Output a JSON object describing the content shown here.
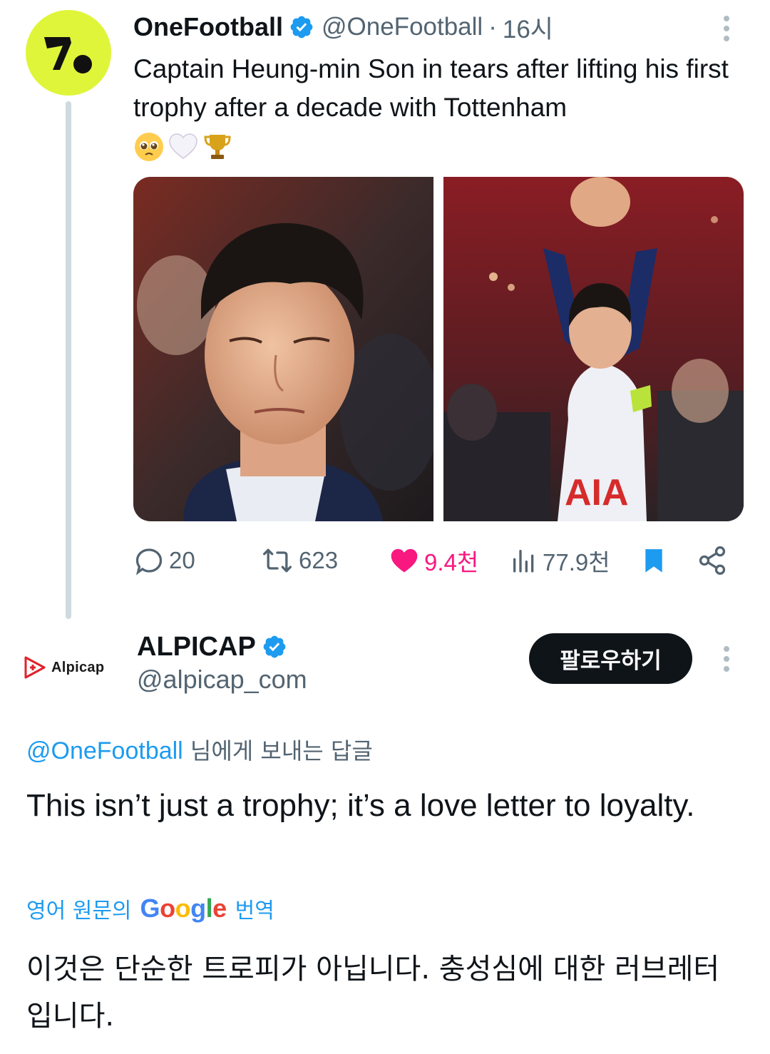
{
  "parent_tweet": {
    "author_name": "OneFootball",
    "handle": "@OneFootball",
    "separator": "·",
    "time": "16시",
    "text": "Captain Heung-min Son in tears after lifting his first trophy after a decade with Tottenham",
    "emojis": [
      "pleading-face",
      "white-heart",
      "trophy"
    ],
    "media": [
      {
        "alt": "Heung-min Son close-up in tears"
      },
      {
        "alt": "Heung-min Son applauding fans with captain armband"
      }
    ],
    "stats": {
      "replies": "20",
      "retweets": "623",
      "likes": "9.4천",
      "views": "77.9천"
    }
  },
  "reply_tweet": {
    "brand_text": "Alpicap",
    "author_name": "ALPICAP",
    "handle": "@alpicap_com",
    "follow_label": "팔로우하기",
    "reply_to_mention": "@OneFootball",
    "reply_to_suffix": " 님에게 보내는 답글",
    "text": "This isn’t just a trophy; it’s a love letter to loyalty.",
    "translate_prefix": "영어 원문의",
    "translate_brand": "Google",
    "translate_suffix": "번역",
    "translated_text": "이것은 단순한 트로피가 아닙니다. 충성심에 대한 러브레터입니다."
  },
  "colors": {
    "text_primary": "#0f1419",
    "text_secondary": "#536471",
    "link": "#1d9bf0",
    "like": "#f91880",
    "verified": "#1d9bf0",
    "onefootball_brand": "#dff53a",
    "follow_button": "#0f1419"
  }
}
